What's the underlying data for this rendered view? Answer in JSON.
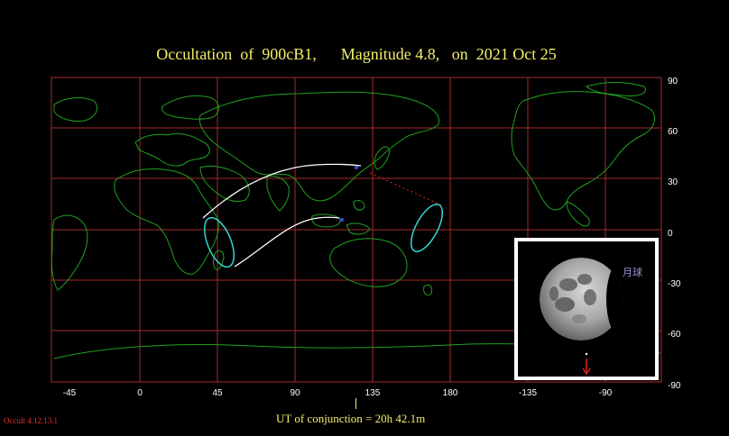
{
  "title": {
    "text": "Occultation  of  900cB1,      Magnitude 4.8,   on  2021 Oct 25"
  },
  "axes": {
    "x_ticks": [
      "-45",
      "0",
      "45",
      "90",
      "135",
      "180",
      "-135",
      "-90"
    ],
    "y_ticks": [
      "90",
      "60",
      "30",
      "0",
      "-30",
      "-60",
      "-90"
    ]
  },
  "footer": {
    "ut_conjunction": "UT of conjunction = 20h 42.1m",
    "version": "Occult 4.12.13.1"
  },
  "inset": {
    "moon_label": "月球"
  },
  "colors": {
    "grid": "#a82a2a",
    "coast": "#1fa21f",
    "path": "#ffffff",
    "limb": "#33d6d6",
    "title": "#f4ef6a",
    "arrow": "#e02020"
  }
}
